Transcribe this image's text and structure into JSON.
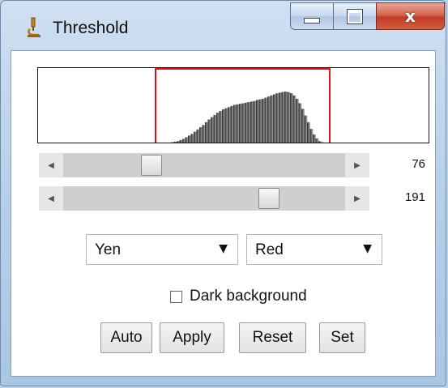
{
  "window": {
    "title": "Threshold"
  },
  "titlebar_buttons": {
    "minimize_icon": "minimize-icon",
    "maximize_icon": "maximize-icon",
    "close_icon": "close-icon",
    "close_glyph": "x"
  },
  "histogram": {
    "threshold_color": "#dd1111",
    "lower_threshold": 76,
    "upper_threshold": 191,
    "bins": [
      0,
      0,
      1,
      1,
      2,
      3,
      4,
      6,
      8,
      11,
      14,
      17,
      21,
      25,
      29,
      33,
      38,
      43,
      47,
      51,
      55,
      58,
      61,
      63,
      65,
      67,
      69,
      70,
      71,
      72,
      73,
      74,
      75,
      76,
      78,
      79,
      80,
      82,
      84,
      86,
      88,
      90,
      91,
      92,
      93,
      92,
      90,
      86,
      80,
      72,
      62,
      50,
      38,
      26,
      16,
      9,
      4,
      2,
      1,
      0
    ]
  },
  "sliders": [
    {
      "value": "76",
      "position": 0.298
    },
    {
      "value": "191",
      "position": 0.749
    }
  ],
  "method_dropdown": {
    "value": "Yen"
  },
  "display_dropdown": {
    "value": "Red"
  },
  "dark_background": {
    "label": "Dark background",
    "checked": false
  },
  "buttons": {
    "auto": "Auto",
    "apply": "Apply",
    "reset": "Reset",
    "set": "Set"
  }
}
